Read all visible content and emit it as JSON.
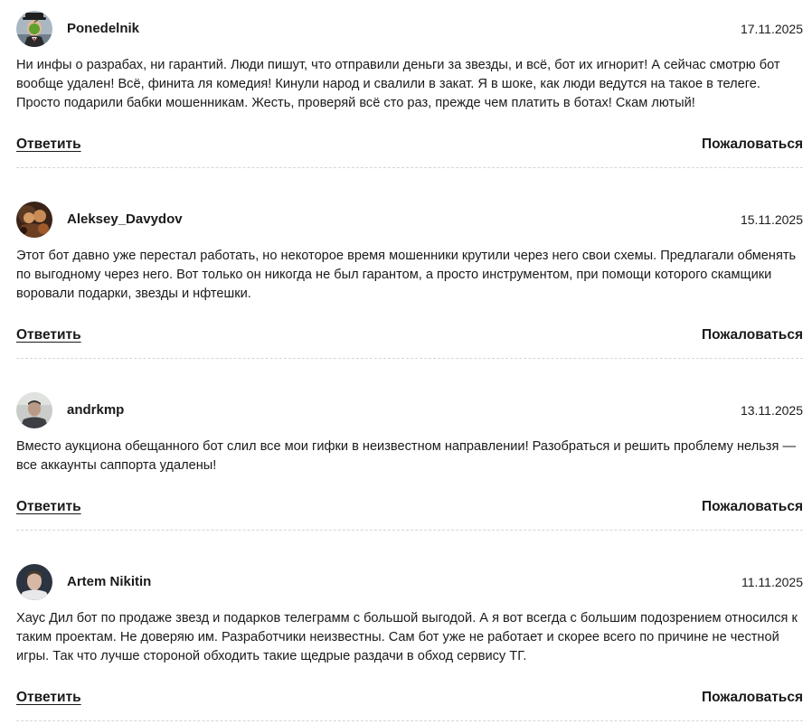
{
  "comments": [
    {
      "author": "Ponedelnik",
      "avatar": "green-apple-face-avatar",
      "date": "17.11.2025",
      "text": "Ни инфы о разрабах, ни гарантий. Люди пишут, что отправили деньги за звезды, и всё, бот их игнорит! А сейчас смотрю бот вообще удален! Всё, финита ля комедия! Кинули народ и свалили в закат. Я в шоке, как люди ведутся на такое в телеге. Просто подарили бабки мошенникам. Жесть, проверяй всё сто раз, прежде чем платить в ботах! Скам лютый!",
      "reply_label": "Ответить",
      "report_label": "Пожаловаться"
    },
    {
      "author": "Aleksey_Davydov",
      "avatar": "painting-portrait-avatar",
      "date": "15.11.2025",
      "text": "Этот бот давно уже перестал работать, но некоторое время мошенники крутили через него свои схемы. Предлагали обменять по выгодному через него. Вот только он никогда не был гарантом, а просто инструментом, при помощи которого скамщики воровали подарки, звезды и нфтешки.",
      "reply_label": "Ответить",
      "report_label": "Пожаловаться"
    },
    {
      "author": "andrkmp",
      "avatar": "person-photo-avatar",
      "date": "13.11.2025",
      "text": "Вместо аукциона обещанного бот слил все мои гифки в неизвестном направлении! Разобраться и решить проблему нельзя — все аккаунты саппорта удалены!",
      "reply_label": "Ответить",
      "report_label": "Пожаловаться"
    },
    {
      "author": "Artem Nikitin",
      "avatar": "person-photo-avatar",
      "date": "11.11.2025",
      "text": "Хаус Дил бот по продаже звезд и подарков телеграмм с большой выгодой. А я вот всегда с большим подозрением относился к таким проектам. Не доверяю им. Разработчики неизвестны. Сам бот уже не работает и скорее всего по причине не честной игры. Так что лучше стороной обходить такие щедрые раздачи в обход сервису ТГ.",
      "reply_label": "Ответить",
      "report_label": "Пожаловаться"
    }
  ]
}
